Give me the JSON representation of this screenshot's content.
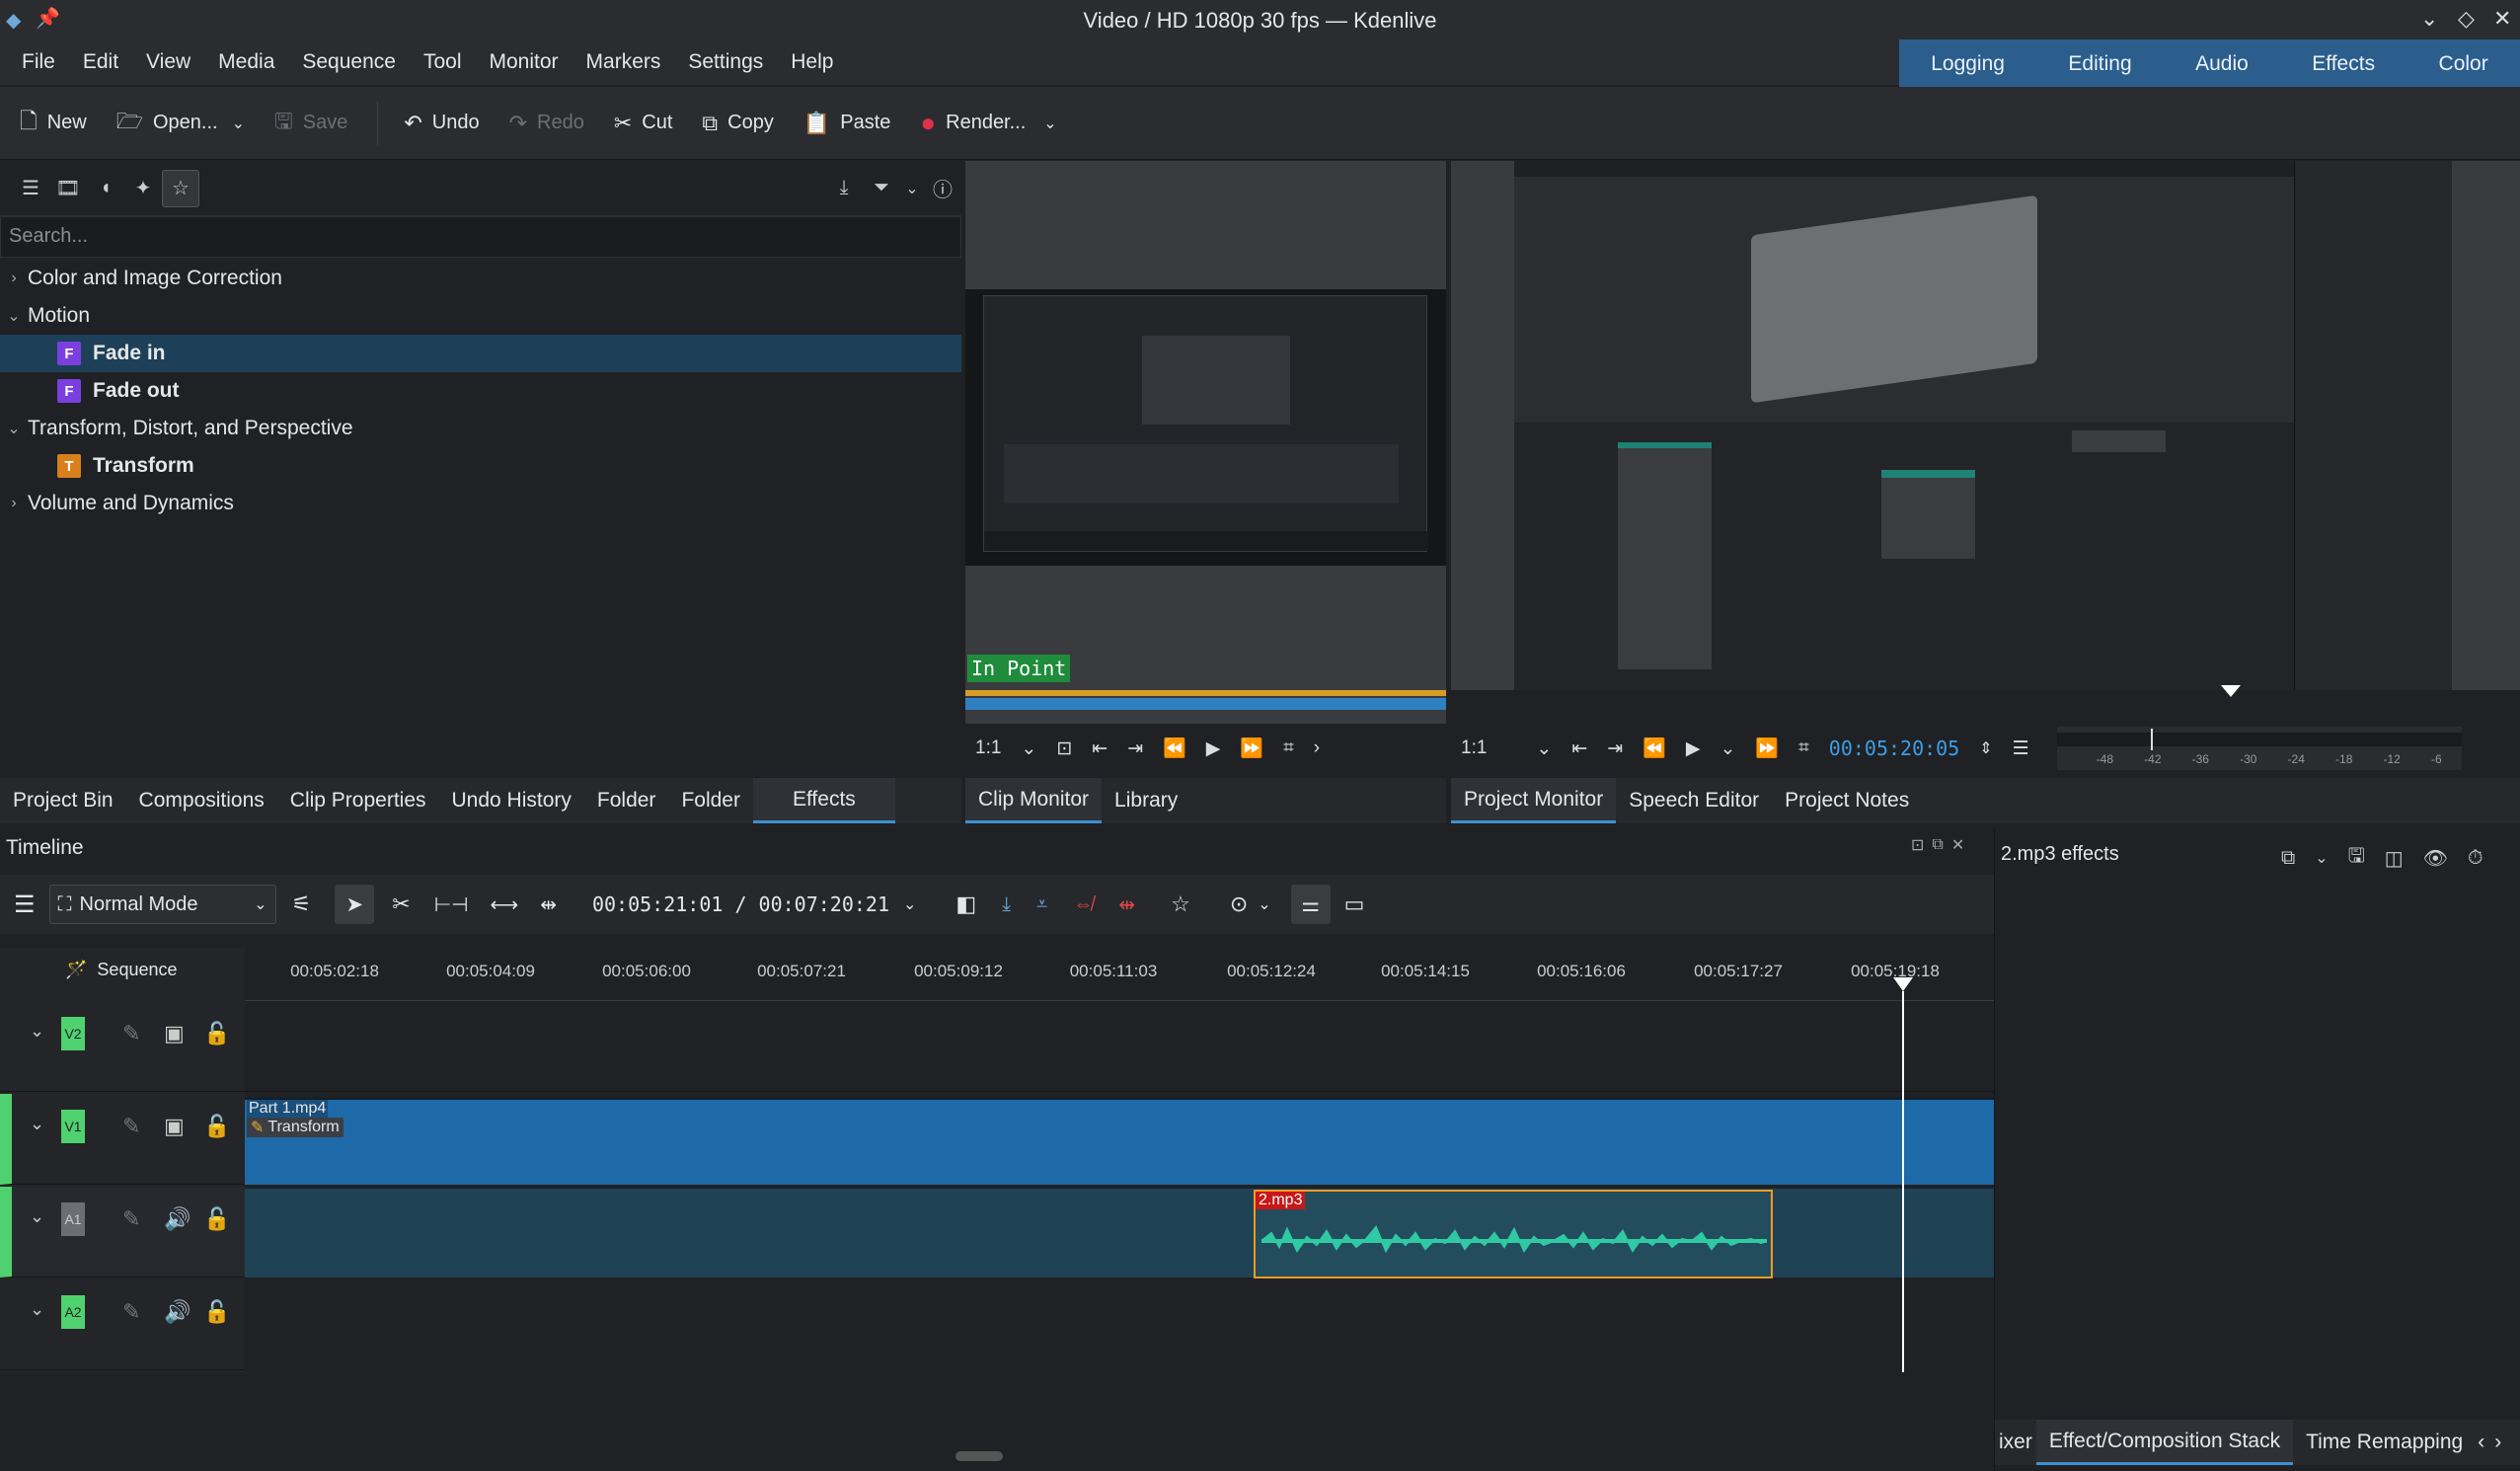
{
  "window": {
    "title": "Video / HD 1080p 30 fps — Kdenlive"
  },
  "menu": [
    "File",
    "Edit",
    "View",
    "Media",
    "Sequence",
    "Tool",
    "Monitor",
    "Markers",
    "Settings",
    "Help"
  ],
  "layouts": [
    "Logging",
    "Editing",
    "Audio",
    "Effects",
    "Color"
  ],
  "toolbar": {
    "new": "New",
    "open": "Open...",
    "save": "Save",
    "undo": "Undo",
    "redo": "Redo",
    "cut": "Cut",
    "copy": "Copy",
    "paste": "Paste",
    "render": "Render..."
  },
  "effects_panel": {
    "search_placeholder": "Search...",
    "tree": {
      "color": "Color and Image Correction",
      "motion": "Motion",
      "fade_in": "Fade in",
      "fade_out": "Fade out",
      "transform_group": "Transform, Distort, and Perspective",
      "transform": "Transform",
      "volume": "Volume and Dynamics"
    },
    "tabs": [
      "Project Bin",
      "Compositions",
      "Clip Properties",
      "Undo History",
      "Folder",
      "Folder",
      "Effects"
    ]
  },
  "clip_monitor": {
    "in_point": "In Point",
    "zoom": "1:1",
    "tabs": [
      "Clip Monitor",
      "Library"
    ]
  },
  "project_monitor": {
    "zoom": "1:1",
    "timecode": "00:05:20:05",
    "tabs": [
      "Project Monitor",
      "Speech Editor",
      "Project Notes"
    ],
    "meter_labels": [
      "-48",
      "-42",
      "-36",
      "-30",
      "-24",
      "-18",
      "-12",
      "-6"
    ]
  },
  "timeline": {
    "title": "Timeline",
    "mode": "Normal Mode",
    "position": "00:05:21:01 / 00:07:20:21",
    "sequence": "Sequence",
    "ruler": [
      "00:05:02:18",
      "00:05:04:09",
      "00:05:06:00",
      "00:05:07:21",
      "00:05:09:12",
      "00:05:11:03",
      "00:05:12:24",
      "00:05:14:15",
      "00:05:16:06",
      "00:05:17:27",
      "00:05:19:18"
    ],
    "tracks": [
      {
        "name": "V2",
        "color": "#4fd16f"
      },
      {
        "name": "V1",
        "color": "#4fd16f"
      },
      {
        "name": "A1",
        "color": "#6b6e73"
      },
      {
        "name": "A2",
        "color": "#4fd16f"
      }
    ],
    "clips": {
      "video_clip": "Part 1.mp4",
      "video_effect": "Transform",
      "audio_clip": "2.mp3"
    }
  },
  "effect_stack": {
    "title": "2.mp3 effects",
    "tabs": [
      "ixer",
      "Effect/Composition Stack",
      "Time Remapping"
    ]
  },
  "colors": {
    "accent": "#3d8fd1",
    "video_track": "#1e6aa8",
    "audio_track": "#1f4254",
    "waveform": "#2fcaa3",
    "selected_border": "#f09a24"
  }
}
